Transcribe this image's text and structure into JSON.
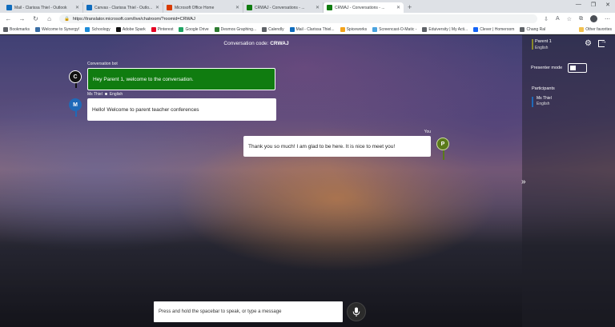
{
  "browser": {
    "tabs": [
      {
        "title": "Mail - Clarissa Thiel - Outlook",
        "color": "#0f6cbd"
      },
      {
        "title": "Canvas - Clarissa Thiel - Outlo...",
        "color": "#0f6cbd"
      },
      {
        "title": "Microsoft Office Home",
        "color": "#d83b01"
      },
      {
        "title": "CRWAJ - Conversations - ...",
        "color": "#107c10"
      },
      {
        "title": "CRWAJ - Conversations - ...",
        "color": "#107c10",
        "active": true
      }
    ],
    "new_tab": "+",
    "url": "https://translator.microsoft.com/live/chatroom/?roomid=CRWAJ",
    "bookmarks": [
      {
        "label": "Bookmarks",
        "color": "#5f6368"
      },
      {
        "label": "Welcome to Synergy!",
        "color": "#3a6ea5"
      },
      {
        "label": "Schoology",
        "color": "#1d8cd8"
      },
      {
        "label": "Adobe Spark",
        "color": "#111111"
      },
      {
        "label": "Pinterest",
        "color": "#e60023"
      },
      {
        "label": "Google Drive",
        "color": "#1fa463"
      },
      {
        "label": "Desmos Graphing...",
        "color": "#2f7d32"
      },
      {
        "label": "Calendly",
        "color": "#5f6368"
      },
      {
        "label": "Mail - Clarissa Thiel...",
        "color": "#0f6cbd"
      },
      {
        "label": "Spiceworks",
        "color": "#f3a31b"
      },
      {
        "label": "Screencast-O-Matic -",
        "color": "#4aa3df"
      },
      {
        "label": "Eduiversity | My Acti...",
        "color": "#5f6368"
      },
      {
        "label": "Clever | Homeroom",
        "color": "#1464f6"
      },
      {
        "label": "Chang Ral",
        "color": "#5f6368"
      }
    ],
    "other_bookmarks": "Other favorites"
  },
  "conversation": {
    "code_label": "Conversation code:",
    "code_value": "CRWAJ"
  },
  "messages": [
    {
      "sender": "Conversation bot",
      "initial": "C",
      "text": "Hey Parent 1, welcome to the conversation.",
      "kind": "bot"
    },
    {
      "sender": "Ms Thiel",
      "lang": "English",
      "initial": "M",
      "text": "Hello! Welcome to parent teacher conferences",
      "kind": "other"
    },
    {
      "sender": "You",
      "initial": "P",
      "text": "Thank you so much! I am glad to be here. It is nice to meet you!",
      "kind": "self"
    }
  ],
  "panel": {
    "me_name": "Parent 1",
    "me_lang": "English",
    "presenter_label": "Presenter mode",
    "participants_label": "Participants",
    "participants": [
      {
        "name": "Ms Thiel",
        "lang": "English"
      }
    ],
    "expand": "»"
  },
  "input": {
    "placeholder": "Press and hold the spacebar to speak, or type a message"
  },
  "colors": {
    "bot_bubble": "#107c10",
    "avatar_bot": "#111111",
    "avatar_ms_thiel": "#1f6ab8",
    "avatar_you": "#5a7a1a"
  }
}
